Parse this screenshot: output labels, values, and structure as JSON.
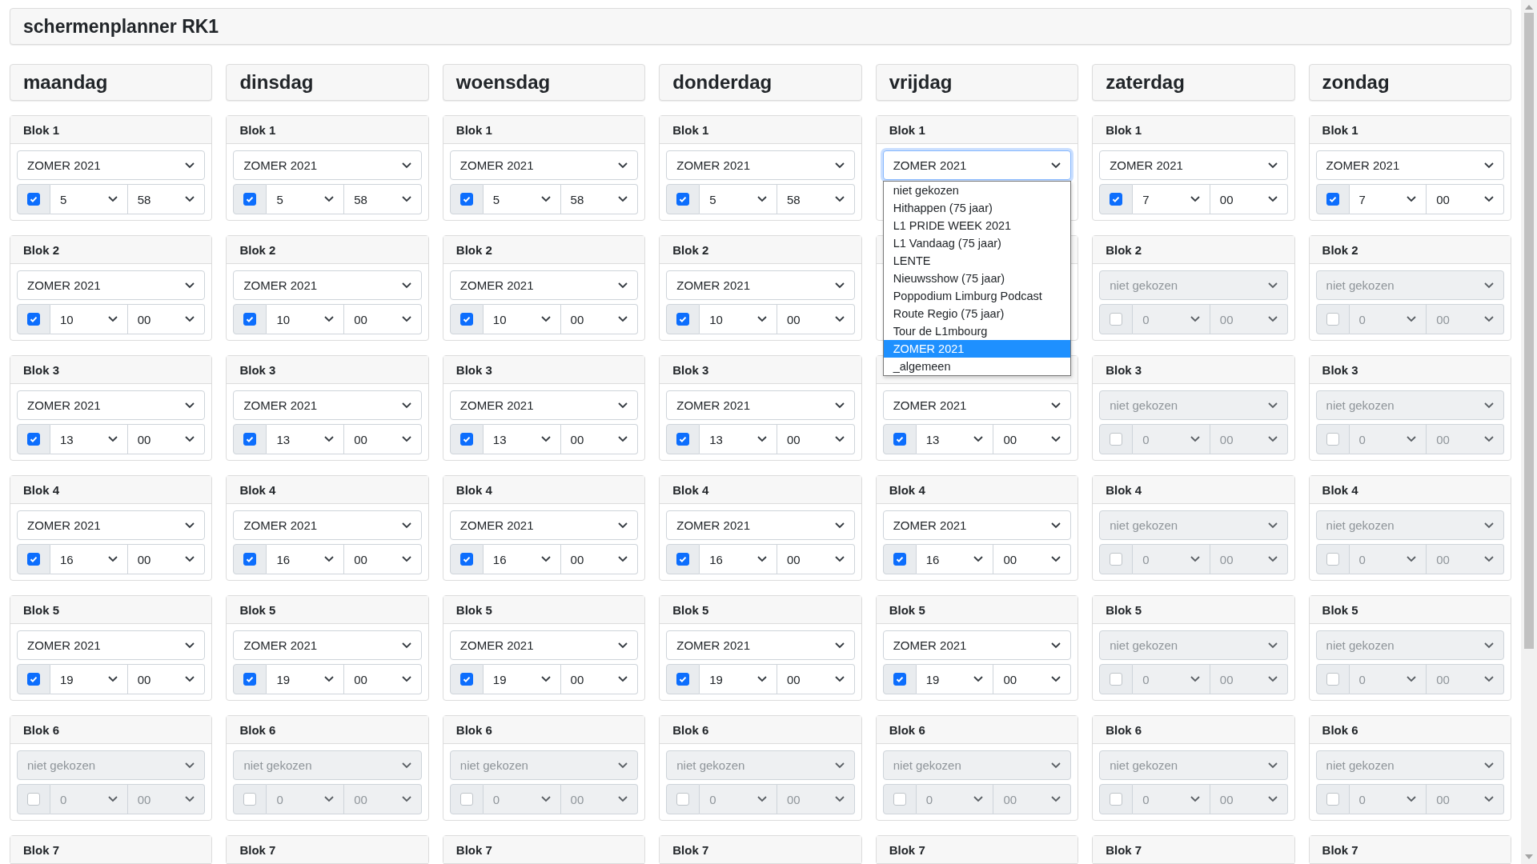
{
  "title": "schermenplanner RK1",
  "days": [
    {
      "name": "maandag",
      "blocks": [
        {
          "title": "Blok 1",
          "program": "ZOMER 2021",
          "checked": true,
          "hour": "5",
          "minute": "58"
        },
        {
          "title": "Blok 2",
          "program": "ZOMER 2021",
          "checked": true,
          "hour": "10",
          "minute": "00"
        },
        {
          "title": "Blok 3",
          "program": "ZOMER 2021",
          "checked": true,
          "hour": "13",
          "minute": "00"
        },
        {
          "title": "Blok 4",
          "program": "ZOMER 2021",
          "checked": true,
          "hour": "16",
          "minute": "00"
        },
        {
          "title": "Blok 5",
          "program": "ZOMER 2021",
          "checked": true,
          "hour": "19",
          "minute": "00"
        },
        {
          "title": "Blok 6",
          "program": "niet gekozen",
          "checked": false,
          "hour": "0",
          "minute": "00"
        },
        {
          "title": "Blok 7"
        }
      ]
    },
    {
      "name": "dinsdag",
      "blocks": [
        {
          "title": "Blok 1",
          "program": "ZOMER 2021",
          "checked": true,
          "hour": "5",
          "minute": "58"
        },
        {
          "title": "Blok 2",
          "program": "ZOMER 2021",
          "checked": true,
          "hour": "10",
          "minute": "00"
        },
        {
          "title": "Blok 3",
          "program": "ZOMER 2021",
          "checked": true,
          "hour": "13",
          "minute": "00"
        },
        {
          "title": "Blok 4",
          "program": "ZOMER 2021",
          "checked": true,
          "hour": "16",
          "minute": "00"
        },
        {
          "title": "Blok 5",
          "program": "ZOMER 2021",
          "checked": true,
          "hour": "19",
          "minute": "00"
        },
        {
          "title": "Blok 6",
          "program": "niet gekozen",
          "checked": false,
          "hour": "0",
          "minute": "00"
        },
        {
          "title": "Blok 7"
        }
      ]
    },
    {
      "name": "woensdag",
      "blocks": [
        {
          "title": "Blok 1",
          "program": "ZOMER 2021",
          "checked": true,
          "hour": "5",
          "minute": "58"
        },
        {
          "title": "Blok 2",
          "program": "ZOMER 2021",
          "checked": true,
          "hour": "10",
          "minute": "00"
        },
        {
          "title": "Blok 3",
          "program": "ZOMER 2021",
          "checked": true,
          "hour": "13",
          "minute": "00"
        },
        {
          "title": "Blok 4",
          "program": "ZOMER 2021",
          "checked": true,
          "hour": "16",
          "minute": "00"
        },
        {
          "title": "Blok 5",
          "program": "ZOMER 2021",
          "checked": true,
          "hour": "19",
          "minute": "00"
        },
        {
          "title": "Blok 6",
          "program": "niet gekozen",
          "checked": false,
          "hour": "0",
          "minute": "00"
        },
        {
          "title": "Blok 7"
        }
      ]
    },
    {
      "name": "donderdag",
      "blocks": [
        {
          "title": "Blok 1",
          "program": "ZOMER 2021",
          "checked": true,
          "hour": "5",
          "minute": "58"
        },
        {
          "title": "Blok 2",
          "program": "ZOMER 2021",
          "checked": true,
          "hour": "10",
          "minute": "00"
        },
        {
          "title": "Blok 3",
          "program": "ZOMER 2021",
          "checked": true,
          "hour": "13",
          "minute": "00"
        },
        {
          "title": "Blok 4",
          "program": "ZOMER 2021",
          "checked": true,
          "hour": "16",
          "minute": "00"
        },
        {
          "title": "Blok 5",
          "program": "ZOMER 2021",
          "checked": true,
          "hour": "19",
          "minute": "00"
        },
        {
          "title": "Blok 6",
          "program": "niet gekozen",
          "checked": false,
          "hour": "0",
          "minute": "00"
        },
        {
          "title": "Blok 7"
        }
      ]
    },
    {
      "name": "vrijdag",
      "blocks": [
        {
          "title": "Blok 1",
          "program": "ZOMER 2021",
          "dropdown": [
            {
              "label": "niet gekozen",
              "selected": false
            },
            {
              "label": "Hithappen (75 jaar)",
              "selected": false
            },
            {
              "label": "L1 PRIDE WEEK 2021",
              "selected": false
            },
            {
              "label": "L1 Vandaag (75 jaar)",
              "selected": false
            },
            {
              "label": "LENTE",
              "selected": false
            },
            {
              "label": "Nieuwsshow (75 jaar)",
              "selected": false
            },
            {
              "label": "Poppodium Limburg Podcast",
              "selected": false
            },
            {
              "label": "Route Regio (75 jaar)",
              "selected": false
            },
            {
              "label": "Tour de L1mbourg",
              "selected": false
            },
            {
              "label": "ZOMER 2021",
              "selected": true
            },
            {
              "label": "_algemeen",
              "selected": false
            }
          ]
        },
        {
          "kind": "covered"
        },
        {
          "program": "ZOMER 2021",
          "checked": true,
          "hour": "13",
          "minute": "00"
        },
        {
          "title": "Blok 4",
          "program": "ZOMER 2021",
          "checked": true,
          "hour": "16",
          "minute": "00"
        },
        {
          "title": "Blok 5",
          "program": "ZOMER 2021",
          "checked": true,
          "hour": "19",
          "minute": "00"
        },
        {
          "title": "Blok 6",
          "program": "niet gekozen",
          "checked": false,
          "hour": "0",
          "minute": "00"
        },
        {
          "title": "Blok 7"
        }
      ]
    },
    {
      "name": "zaterdag",
      "blocks": [
        {
          "title": "Blok 1",
          "program": "ZOMER 2021",
          "checked": true,
          "hour": "7",
          "minute": "00"
        },
        {
          "title": "Blok 2",
          "program": "niet gekozen",
          "checked": false,
          "hour": "0",
          "minute": "00"
        },
        {
          "title": "Blok 3",
          "program": "niet gekozen",
          "checked": false,
          "hour": "0",
          "minute": "00"
        },
        {
          "title": "Blok 4",
          "program": "niet gekozen",
          "checked": false,
          "hour": "0",
          "minute": "00"
        },
        {
          "title": "Blok 5",
          "program": "niet gekozen",
          "checked": false,
          "hour": "0",
          "minute": "00"
        },
        {
          "title": "Blok 6",
          "program": "niet gekozen",
          "checked": false,
          "hour": "0",
          "minute": "00"
        },
        {
          "title": "Blok 7"
        }
      ]
    },
    {
      "name": "zondag",
      "blocks": [
        {
          "title": "Blok 1",
          "program": "ZOMER 2021",
          "checked": true,
          "hour": "7",
          "minute": "00"
        },
        {
          "title": "Blok 2",
          "program": "niet gekozen",
          "checked": false,
          "hour": "0",
          "minute": "00"
        },
        {
          "title": "Blok 3",
          "program": "niet gekozen",
          "checked": false,
          "hour": "0",
          "minute": "00"
        },
        {
          "title": "Blok 4",
          "program": "niet gekozen",
          "checked": false,
          "hour": "0",
          "minute": "00"
        },
        {
          "title": "Blok 5",
          "program": "niet gekozen",
          "checked": false,
          "hour": "0",
          "minute": "00"
        },
        {
          "title": "Blok 6",
          "program": "niet gekozen",
          "checked": false,
          "hour": "0",
          "minute": "00"
        },
        {
          "title": "Blok 7"
        }
      ]
    }
  ]
}
